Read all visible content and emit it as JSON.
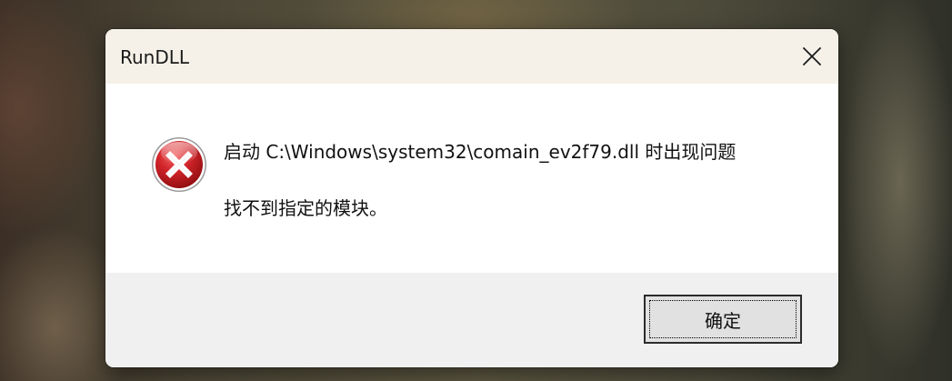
{
  "window": {
    "title": "RunDLL"
  },
  "message": {
    "line1": "启动 C:\\Windows\\system32\\comain_ev2f79.dll 时出现问题",
    "line2": "找不到指定的模块。"
  },
  "buttons": {
    "ok_label": "确定"
  },
  "icons": {
    "error": "error-icon",
    "close": "close-icon"
  },
  "colors": {
    "error_red": "#c8151b",
    "titlebar": "#f5f1e8",
    "content_bg": "#ffffff",
    "footer_bg": "#f0f0f0"
  }
}
